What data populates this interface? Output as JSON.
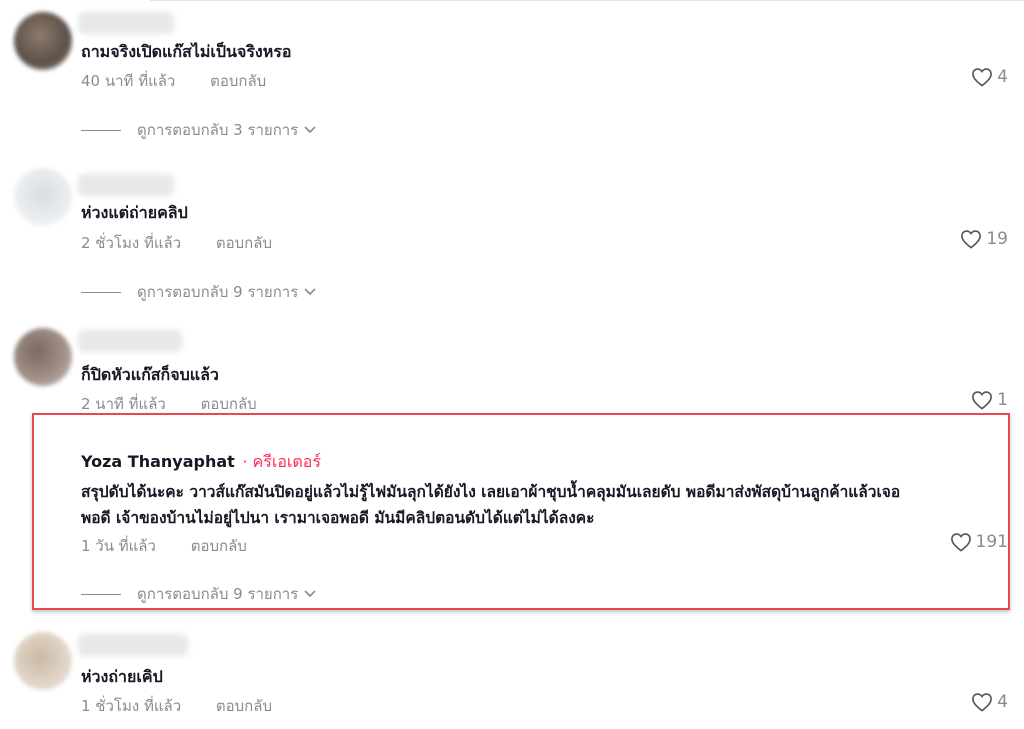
{
  "comments": [
    {
      "text": "ถามจริงเปิดแก๊สไม่เป็นจริงหรอ",
      "time": "40 นาที ที่แล้ว",
      "reply_label": "ตอบกลับ",
      "likes": "4",
      "view_replies": "ดูการตอบกลับ 3 รายการ"
    },
    {
      "text": "ห่วงแต่ถ่ายคลิป",
      "time": "2 ชั่วโมง ที่แล้ว",
      "reply_label": "ตอบกลับ",
      "likes": "19",
      "view_replies": "ดูการตอบกลับ 9 รายการ"
    },
    {
      "text": "ก็ปิดหัวแก๊สก็จบแล้ว",
      "time": "2 นาที ที่แล้ว",
      "reply_label": "ตอบกลับ",
      "likes": "1"
    },
    {
      "author": "Yoza Thanyaphat",
      "author_badge": "· ครีเอเตอร์",
      "line1": "สรุปดับได้นะคะ วาวส์แก๊สมันปิดอยู่แล้วไม่รู้ไฟมันลุกได้ยังไง เลยเอาผ้าชุบน้ำคลุมมันเลยดับ พอดีมาส่งพัสดุบ้านลูกค้าแล้วเจอ",
      "line2": "พอดี เจ้าของบ้านไม่อยู่ไปนา เรามาเจอพอดี มันมีคลิปตอนดับได้แต่ไม่ได้ลงคะ",
      "time": "1 วัน ที่แล้ว",
      "reply_label": "ตอบกลับ",
      "likes": "191",
      "view_replies": "ดูการตอบกลับ 9 รายการ"
    },
    {
      "text": "ห่วงถ่ายเคิป",
      "time": "1 ชั่วโมง ที่แล้ว",
      "reply_label": "ตอบกลับ",
      "likes": "4"
    }
  ],
  "colors": {
    "highlight_border": "#e24b4f",
    "creator_badge": "#fe2c55",
    "meta_text": "#8a8b91"
  }
}
